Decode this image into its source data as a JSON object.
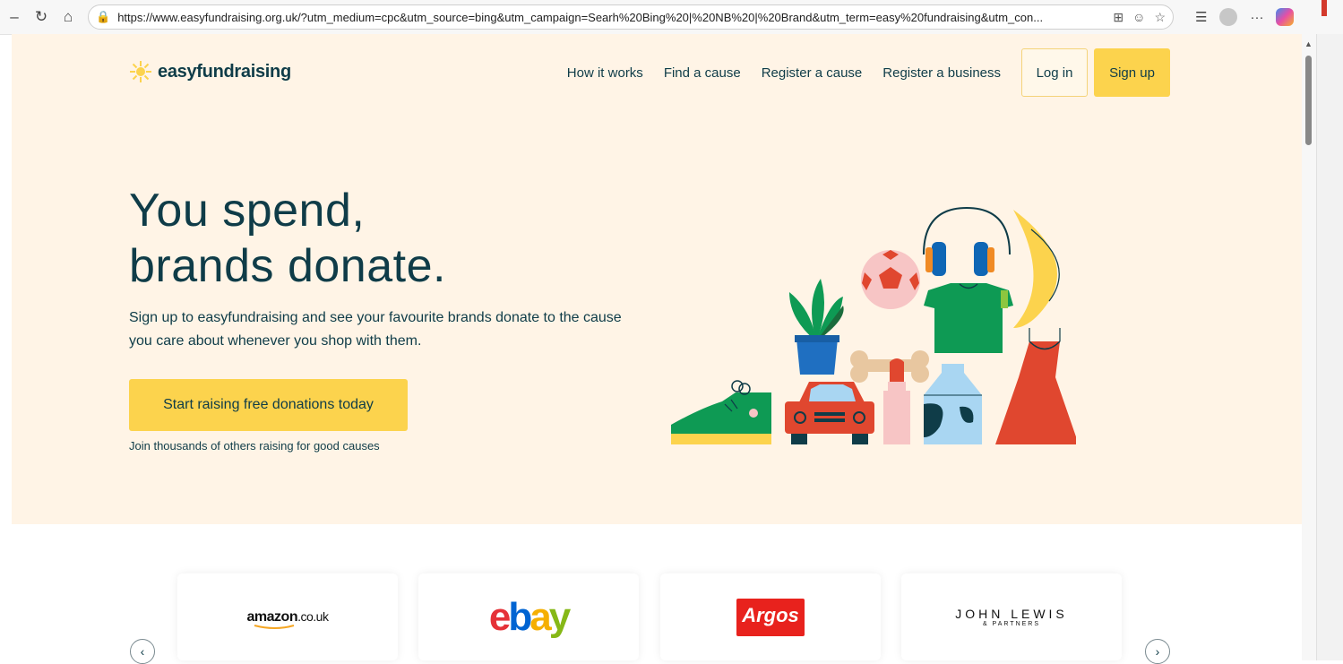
{
  "browser": {
    "url": "https://www.easyfundraising.org.uk/?utm_medium=cpc&utm_source=bing&utm_campaign=Searh%20Bing%20|%20NB%20|%20Brand&utm_term=easy%20fundraising&utm_con...",
    "icons": [
      "back-icon",
      "refresh-icon",
      "home-icon",
      "lock-icon",
      "split-screen-icon",
      "reader-icon",
      "favorite-icon",
      "collections-icon",
      "profile-icon",
      "more-icon",
      "copilot-icon"
    ]
  },
  "header": {
    "logo_text": "easyfundraising",
    "nav": [
      "How it works",
      "Find a cause",
      "Register a cause",
      "Register a business"
    ],
    "login_label": "Log in",
    "signup_label": "Sign up"
  },
  "hero": {
    "headline_line1": "You spend,",
    "headline_line2": "brands donate.",
    "subtext": "Sign up to easyfundraising and see your favourite brands donate to the cause you care about whenever you shop with them.",
    "cta_label": "Start raising free donations today",
    "cta_note": "Join thousands of others raising for good causes"
  },
  "brands": {
    "cards": [
      "amazon.co.uk",
      "ebay",
      "Argos",
      "JOHN LEWIS"
    ],
    "amazon_a": "amazon",
    "amazon_b": ".co.uk",
    "ebay_letters": [
      "e",
      "b",
      "a",
      "y"
    ],
    "argos": "Argos",
    "jl_line1": "JOHN LEWIS",
    "jl_line2": "& PARTNERS",
    "prev_glyph": "‹",
    "next_glyph": "›"
  },
  "colors": {
    "hero_bg": "#fff4e6",
    "accent_yellow": "#fcd34d",
    "text_dark": "#0f3c48",
    "ebay_e": "#e53238",
    "ebay_b": "#0064d2",
    "ebay_a": "#f5af02",
    "ebay_y": "#86b817",
    "argos_red": "#e8221d"
  }
}
